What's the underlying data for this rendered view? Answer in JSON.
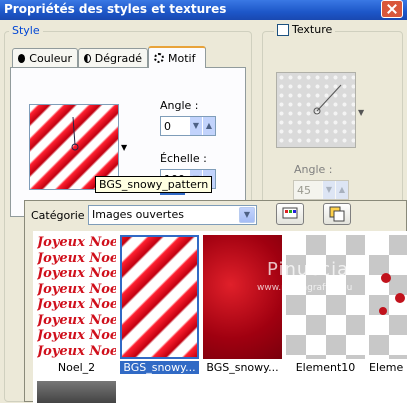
{
  "window": {
    "title": "Propriétés des styles et textures"
  },
  "style_group": {
    "label": "Style",
    "tabs": [
      {
        "label": "Couleur",
        "icon": "filled-circle-icon",
        "active": false
      },
      {
        "label": "Dégradé",
        "icon": "half-circle-icon",
        "active": false
      },
      {
        "label": "Motif",
        "icon": "pattern-icon",
        "active": true
      }
    ],
    "angle_label": "Angle :",
    "angle_value": "0",
    "scale_label": "Échelle :",
    "scale_value": "100"
  },
  "texture_group": {
    "checkbox_label": "Texture",
    "checked": false,
    "angle_label": "Angle :",
    "angle_value": "45"
  },
  "pattern_picker": {
    "category_label": "Catégorie :",
    "category_value": "Images ouvertes",
    "thumbnails": [
      {
        "label": "Noel_2",
        "selected": false,
        "kind": "text",
        "text": "Joyeux Noel"
      },
      {
        "label": "BGS_snowy...",
        "selected": true,
        "kind": "stripes"
      },
      {
        "label": "BGS_snowy...",
        "selected": false,
        "kind": "red"
      },
      {
        "label": "Element10",
        "selected": false,
        "kind": "checker"
      },
      {
        "label": "Eleme",
        "selected": false,
        "kind": "checker-ornaments"
      }
    ],
    "tooltip": "BGS_snowy_pattern",
    "watermark": "Pinuccia",
    "watermark_url": "www.mariagrafica.eu"
  },
  "colors": {
    "accent_blue": "#0046d5",
    "stripe_red": "#c10010",
    "selection": "#316ac5"
  }
}
